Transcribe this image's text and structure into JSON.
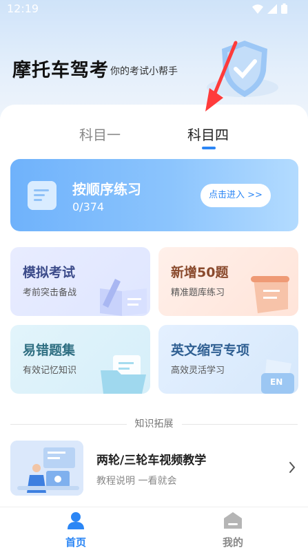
{
  "status_bar": {
    "time": "12:19"
  },
  "header": {
    "title": "摩托车驾考",
    "subtitle": "你的考试小帮手"
  },
  "tabs": [
    {
      "label": "科目一",
      "active": false
    },
    {
      "label": "科目四",
      "active": true
    }
  ],
  "practice": {
    "title": "按顺序练习",
    "progress": "0/374",
    "enter_label": "点击进入 >>"
  },
  "cards": [
    {
      "title": "模拟考试",
      "subtitle": "考前突击备战"
    },
    {
      "title": "新增50题",
      "subtitle": "精准题库练习"
    },
    {
      "title": "易错题集",
      "subtitle": "有效记忆知识"
    },
    {
      "title": "英文缩写专项",
      "subtitle": "高效灵活学习",
      "badge": "EN"
    }
  ],
  "knowledge": {
    "section_title": "知识拓展",
    "video_title": "两轮/三轮车视频教学",
    "video_subtitle": "教程说明 一看就会"
  },
  "bottom_nav": [
    {
      "label": "首页",
      "active": true
    },
    {
      "label": "我的",
      "active": false
    }
  ],
  "colors": {
    "accent": "#2b86f5",
    "arrow": "#ff3b3b"
  }
}
